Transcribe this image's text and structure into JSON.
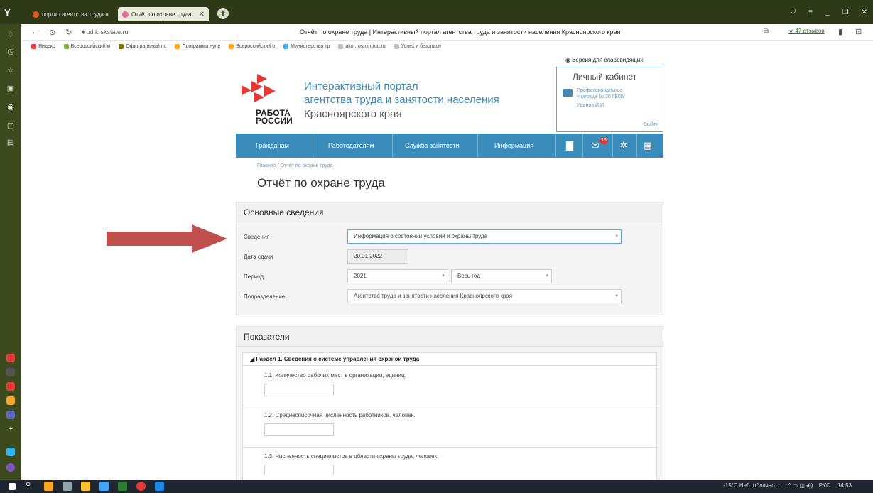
{
  "browser": {
    "tabs": [
      {
        "label": "портал агентства труда н",
        "color": "#e25822"
      },
      {
        "label": "Отчёт по охране труда",
        "color": "#e96b9a"
      }
    ],
    "url": "trud.krskstate.ru",
    "page_title": "Отчёт по охране труда | Интерактивный портал агентства труда и занятости населения Красноярского края",
    "reviews": "★ 47 отзывов",
    "bookmarks": [
      {
        "label": "Яндекс",
        "color": "#e53935"
      },
      {
        "label": "Всероссийский м",
        "color": "#7cb342"
      },
      {
        "label": "Официальный по",
        "color": "#8d6e00"
      },
      {
        "label": "Программа нуле",
        "color": "#f9a825"
      },
      {
        "label": "Всероссийский о",
        "color": "#f9a825"
      },
      {
        "label": "Министерство тр",
        "color": "#42a5f5"
      },
      {
        "label": "akot.rosmintrud.ru",
        "color": "#bdbdbd"
      },
      {
        "label": "Успех и безопасн",
        "color": "#bdbdbd"
      }
    ]
  },
  "portal": {
    "vision_link": "Версия для слабовидящих",
    "title_line1": "Интерактивный портал",
    "title_line2": "агентства труда и занятости населения",
    "region": "Красноярского края",
    "logo_line1": "РАБОТА",
    "logo_line2": "РОССИИ",
    "cabinet": {
      "title": "Личный кабинет",
      "org_line1": "Профессиональное",
      "org_line2": "училище № 20 ГБОУ",
      "user": "Иванов И.И.",
      "exit": "Выйти"
    },
    "menu": [
      "Гражданам",
      "Работодателям",
      "Служба занятости",
      "Информация"
    ],
    "mail_badge": "16",
    "breadcrumb": "Главная / Отчёт по охране труда",
    "heading": "Отчёт по охране труда"
  },
  "basic": {
    "header": "Основные сведения",
    "info_label": "Сведения",
    "info_value": "Информация о состоянии условий и охраны труда",
    "date_label": "Дата сдачи",
    "date_value": "20.01.2022",
    "period_label": "Период",
    "period_year": "2021",
    "period_span": "Весь год",
    "division_label": "Подразделение",
    "division_value": "Агентство труда и занятости населения Красноярского края"
  },
  "indicators": {
    "header": "Показатели",
    "section_title": "Раздел 1. Сведения о системе управления охраной труда",
    "questions": [
      "1.1. Количество рабочих мест в организации, единиц.",
      "1.2. Среднесписочная численность работников, человек.",
      "1.3. Численность специалистов в области охраны труда, человек."
    ]
  },
  "taskbar": {
    "weather": "-15°C Неб. облачно...",
    "lang": "РУС",
    "time": "14:53"
  },
  "colors": {
    "accent": "#3a8dbb",
    "arrow": "#c0504d",
    "logo_red": "#e53935"
  }
}
